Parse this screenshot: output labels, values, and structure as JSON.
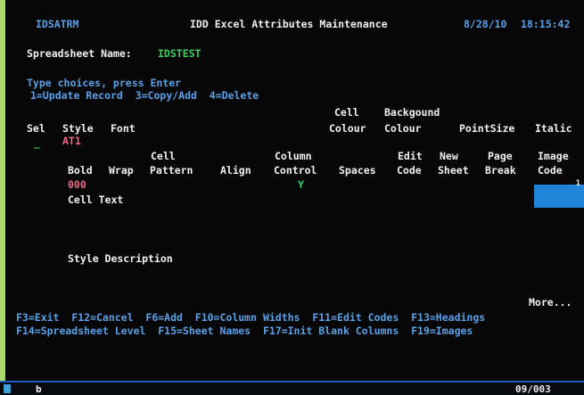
{
  "header": {
    "program": "IDSATRM",
    "title": "IDD Excel Attributes Maintenance",
    "date": "8/28/10",
    "time": "18:15:42"
  },
  "spreadsheet": {
    "label": "Spreadsheet Name:",
    "value": "IDSTEST"
  },
  "instructions": {
    "line1": "Type choices, press Enter",
    "line2": "1=Update Record  3=Copy/Add  4=Delete"
  },
  "columns1": {
    "sel": "Sel",
    "style": "Style",
    "font": "Font",
    "cell_colour_1": "Cell",
    "cell_colour_2": "Colour",
    "bg_colour_1": "Backgound",
    "bg_colour_2": "Colour",
    "point_size": "PointSize",
    "italic": "Italic"
  },
  "row1": {
    "sel_input": "_",
    "style_value": "AT1"
  },
  "columns2": {
    "bold": "Bold",
    "wrap": "Wrap",
    "cell_pattern_1": "Cell",
    "cell_pattern_2": "Pattern",
    "align": "Align",
    "column_control_1": "Column",
    "column_control_2": "Control",
    "spaces": "Spaces",
    "edit_code_1": "Edit",
    "edit_code_2": "Code",
    "new_sheet_1": "New",
    "new_sheet_2": "Sheet",
    "page_break_1": "Page",
    "page_break_2": "Break",
    "image_code_1": "Image",
    "image_code_2": "Code"
  },
  "row2": {
    "cell_pattern_value": "000",
    "column_control_value": "Y",
    "image_code_value": "1"
  },
  "cell_text_label": "Cell Text",
  "style_description_label": "Style Description",
  "more": "More...",
  "fkeys": {
    "line1": "F3=Exit  F12=Cancel  F6=Add  F10=Column Widths  F11=Edit Codes  F13=Headings",
    "line2": "F14=Spreadsheet Level  F15=Sheet Names  F17=Init Blank Columns  F19=Images"
  },
  "statusbar": {
    "input": "b",
    "position": "09/003"
  }
}
